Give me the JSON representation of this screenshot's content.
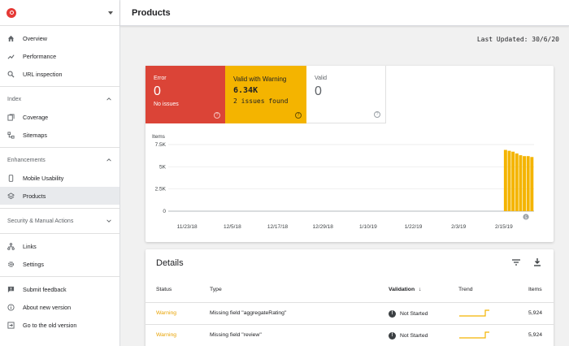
{
  "sidebar": {
    "top_items": [
      {
        "label": "Overview",
        "icon": "home-icon"
      },
      {
        "label": "Performance",
        "icon": "trending-up-icon"
      },
      {
        "label": "URL inspection",
        "icon": "search-icon"
      }
    ],
    "index_section": "Index",
    "index_items": [
      {
        "label": "Coverage",
        "icon": "coverage-icon"
      },
      {
        "label": "Sitemaps",
        "icon": "sitemap-icon"
      }
    ],
    "enhancements_section": "Enhancements",
    "enhancement_items": [
      {
        "label": "Mobile Usability",
        "icon": "phone-icon"
      },
      {
        "label": "Products",
        "icon": "layers-icon"
      }
    ],
    "security_section": "Security & Manual Actions",
    "other_items": [
      {
        "label": "Links",
        "icon": "links-icon"
      },
      {
        "label": "Settings",
        "icon": "gear-icon"
      }
    ],
    "footer_items": [
      {
        "label": "Submit feedback",
        "icon": "feedback-icon"
      },
      {
        "label": "About new version",
        "icon": "info-icon"
      },
      {
        "label": "Go to the old version",
        "icon": "exit-icon"
      }
    ]
  },
  "header": {
    "title": "Products"
  },
  "last_updated": "Last Updated: 30/6/20",
  "summary": {
    "error": {
      "label": "Error",
      "value": "0",
      "sub": "No issues"
    },
    "warning": {
      "label": "Valid with Warning",
      "value": "6.34K",
      "sub": "2 issues found"
    },
    "valid": {
      "label": "Valid",
      "value": "0"
    }
  },
  "chart_data": {
    "type": "bar",
    "ylabel": "Items",
    "yticks": [
      "0",
      "2.5K",
      "5K",
      "7.5K"
    ],
    "ylim": [
      0,
      7500
    ],
    "xticks": [
      "11/23/18",
      "12/5/18",
      "12/17/18",
      "12/29/18",
      "1/10/19",
      "1/22/19",
      "2/3/19",
      "2/15/19"
    ],
    "x_start": "2018-11-18",
    "x_end": "2019-02-23",
    "bars": [
      {
        "date": "2019-02-15",
        "value": 6900
      },
      {
        "date": "2019-02-16",
        "value": 6800
      },
      {
        "date": "2019-02-17",
        "value": 6700
      },
      {
        "date": "2019-02-18",
        "value": 6500
      },
      {
        "date": "2019-02-19",
        "value": 6300
      },
      {
        "date": "2019-02-20",
        "value": 6200
      },
      {
        "date": "2019-02-21",
        "value": 6200
      },
      {
        "date": "2019-02-22",
        "value": 6100
      }
    ],
    "annotation": "5",
    "bar_color": "#f4b400"
  },
  "details": {
    "title": "Details",
    "columns": {
      "status": "Status",
      "type": "Type",
      "validation": "Validation",
      "trend": "Trend",
      "items": "Items"
    },
    "rows": [
      {
        "status": "Warning",
        "type": "Missing field \"aggregateRating\"",
        "validation": "Not Started",
        "items": "5,924"
      },
      {
        "status": "Warning",
        "type": "Missing field \"review\"",
        "validation": "Not Started",
        "items": "5,924"
      }
    ]
  },
  "colors": {
    "error": "#db4437",
    "warning": "#f4b400",
    "accent": "#e8a200"
  }
}
